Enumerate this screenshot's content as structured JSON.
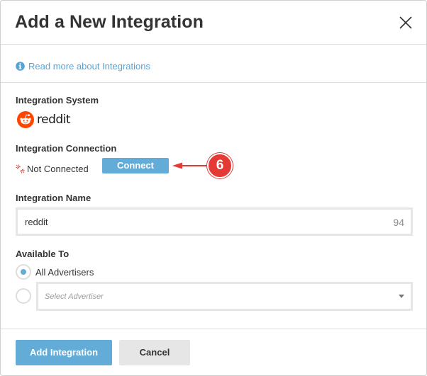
{
  "dialog": {
    "title": "Add a New Integration",
    "info_link": "Read more about Integrations"
  },
  "integration_system": {
    "label": "Integration System",
    "logo_text": "reddit"
  },
  "integration_connection": {
    "label": "Integration Connection",
    "status": "Not Connected",
    "connect_label": "Connect"
  },
  "annotation": {
    "step": "6",
    "color": "#e53935"
  },
  "integration_name": {
    "label": "Integration Name",
    "value": "reddit",
    "char_count": "94"
  },
  "available_to": {
    "label": "Available To",
    "all_advertisers_label": "All Advertisers",
    "all_advertisers_selected": true,
    "select_placeholder": "Select Advertiser"
  },
  "footer": {
    "add_label": "Add Integration",
    "cancel_label": "Cancel"
  },
  "colors": {
    "accent": "#64acd8",
    "link": "#56a4d6",
    "reddit_orange": "#ff4500"
  },
  "icons": {
    "close": "close-icon",
    "info": "info-icon",
    "broken_link": "broken-link-icon",
    "reddit": "reddit-alien-icon"
  }
}
